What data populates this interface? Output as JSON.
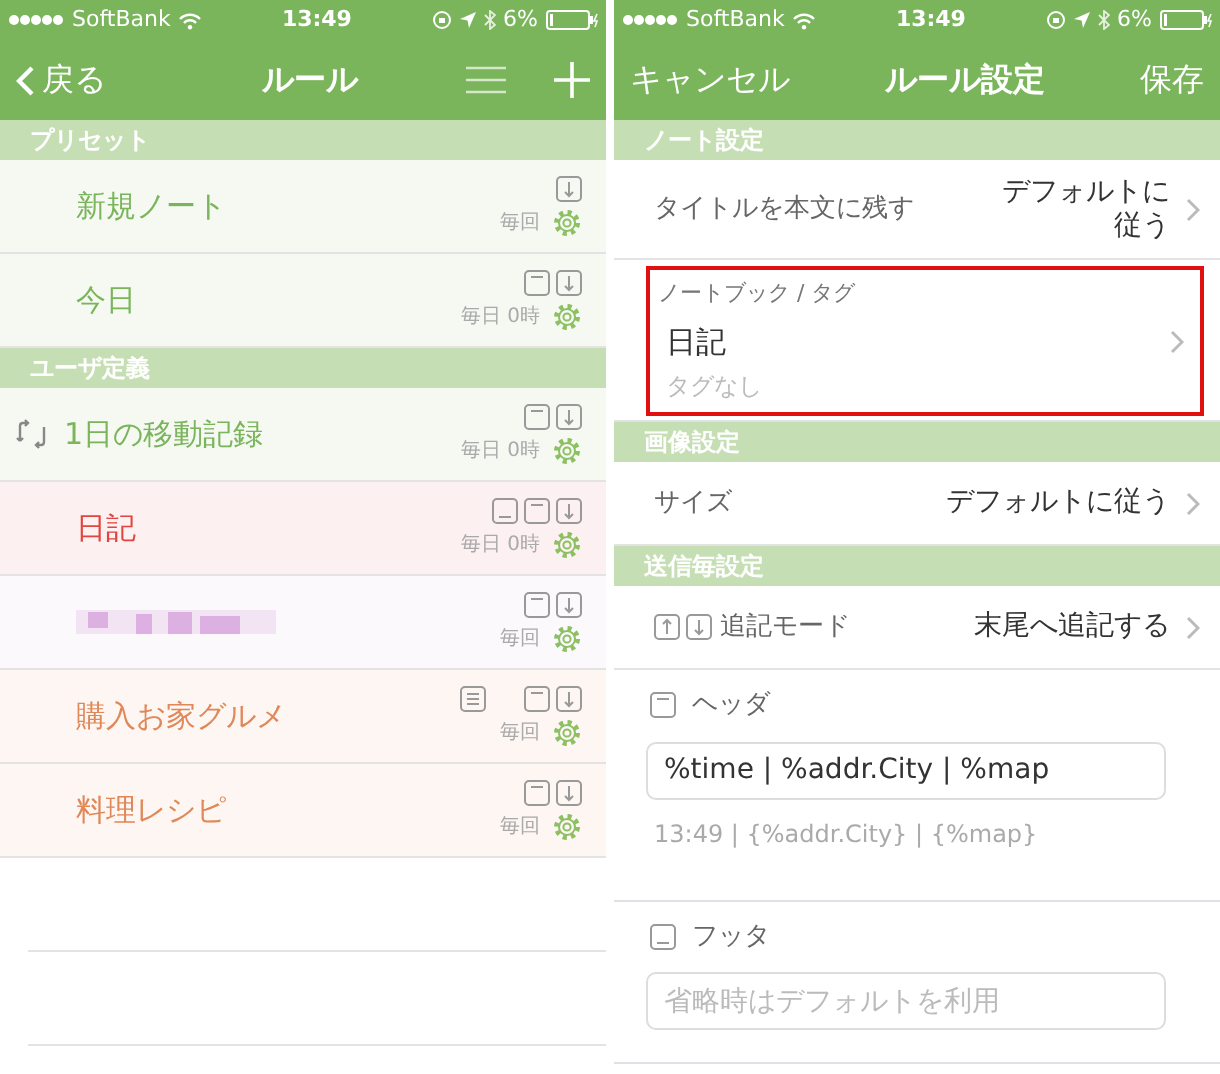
{
  "rules_screen": {
    "status_bar": {
      "carrier": "SoftBank",
      "time": "13:49",
      "battery": "6%"
    },
    "nav": {
      "back": "戻る",
      "title": "ルール"
    },
    "sections": [
      {
        "title": "プリセット",
        "rules": [
          {
            "kind": "text",
            "name": "新規ノート",
            "color": "#7ab55c",
            "repeat": false,
            "icons": [
              {
                "kind": "append"
              }
            ],
            "schedule": "毎回"
          },
          {
            "kind": "text",
            "name": "今日",
            "color": "#7ab55c",
            "repeat": false,
            "icons": [
              {
                "kind": "header"
              },
              {
                "kind": "append"
              }
            ],
            "schedule": "毎日 0時"
          }
        ]
      },
      {
        "title": "ユーザ定義",
        "rules": [
          {
            "kind": "text",
            "name": "1日の移動記録",
            "color": "#7ab55c",
            "repeat": true,
            "icons": [
              {
                "kind": "header"
              },
              {
                "kind": "append"
              }
            ],
            "schedule": "毎日 0時"
          },
          {
            "kind": "text",
            "name": "日記",
            "color": "#e0463f",
            "repeat": false,
            "icons": [
              {
                "kind": "footer"
              },
              {
                "kind": "header"
              },
              {
                "kind": "append"
              }
            ],
            "schedule": "毎日 0時"
          },
          {
            "kind": "redacted",
            "color": "#dcb0e0",
            "repeat": false,
            "icons": [
              {
                "kind": "header"
              },
              {
                "kind": "append"
              }
            ],
            "schedule": "毎回"
          },
          {
            "kind": "text",
            "name": "購入お家グルメ",
            "color": "#e08858",
            "repeat": false,
            "icons": [
              {
                "kind": "body"
              },
              {
                "kind": "blank"
              },
              {
                "kind": "header"
              },
              {
                "kind": "append"
              }
            ],
            "schedule": "毎回"
          },
          {
            "kind": "text",
            "name": "料理レシピ",
            "color": "#e08858",
            "repeat": false,
            "icons": [
              {
                "kind": "header"
              },
              {
                "kind": "append"
              }
            ],
            "schedule": "毎回"
          }
        ]
      }
    ]
  },
  "settings_screen": {
    "status_bar": {
      "carrier": "SoftBank",
      "time": "13:49",
      "battery": "6%"
    },
    "nav": {
      "cancel": "キャンセル",
      "title": "ルール設定",
      "save": "保存"
    },
    "sections": [
      {
        "title": "ノート設定",
        "rows": [
          {
            "kind": "value",
            "label": "タイトルを本文に残す",
            "value": "デフォルトに従う",
            "wrap": true
          },
          {
            "kind": "notebook",
            "caption": "ノートブック / タグ",
            "notebook": "日記",
            "tags": "タグなし",
            "highlighted": true
          }
        ]
      },
      {
        "title": "画像設定",
        "rows": [
          {
            "kind": "value",
            "label": "サイズ",
            "value": "デフォルトに従う"
          }
        ]
      },
      {
        "title": "送信毎設定",
        "rows": [
          {
            "kind": "value",
            "label": "追記モード",
            "icons": [
              {
                "kind": "prepend"
              },
              {
                "kind": "append"
              }
            ],
            "value": "末尾へ追記する"
          },
          {
            "kind": "header",
            "label": "ヘッダ",
            "value": "%time | %addr.City | %map",
            "preview": "13:49 | {%addr.City} | {%map}"
          },
          {
            "kind": "footer",
            "label": "フッタ",
            "placeholder": "省略時はデフォルトを利用"
          }
        ]
      }
    ]
  }
}
